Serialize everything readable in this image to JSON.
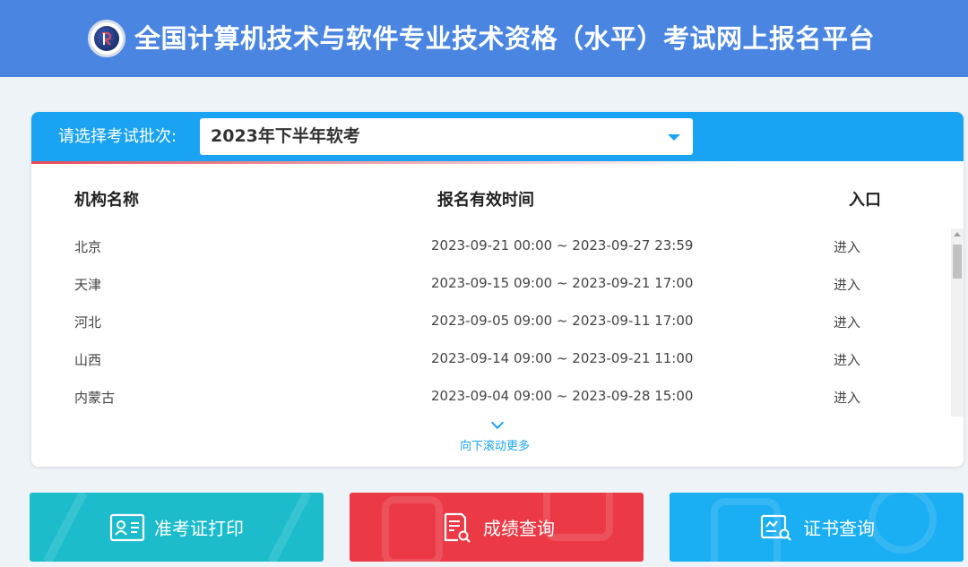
{
  "header": {
    "title": "全国计算机技术与软件专业技术资格（水平）考试网上报名平台"
  },
  "batch": {
    "label": "请选择考试批次:",
    "selected": "2023年下半年软考"
  },
  "table": {
    "columns": [
      "机构名称",
      "报名有效时间",
      "入口"
    ],
    "rows": [
      {
        "name": "北京",
        "time": "2023-09-21 00:00 ~ 2023-09-27 23:59",
        "entry": "进入"
      },
      {
        "name": "天津",
        "time": "2023-09-15 09:00 ~ 2023-09-21 17:00",
        "entry": "进入"
      },
      {
        "name": "河北",
        "time": "2023-09-05 09:00 ~ 2023-09-11 17:00",
        "entry": "进入"
      },
      {
        "name": "山西",
        "time": "2023-09-14 09:00 ~ 2023-09-21 11:00",
        "entry": "进入"
      },
      {
        "name": "内蒙古",
        "time": "2023-09-04 09:00 ~ 2023-09-28 15:00",
        "entry": "进入"
      }
    ]
  },
  "more_hint": "向下滚动更多",
  "actions": [
    {
      "label": "准考证打印",
      "icon": "id-card-icon",
      "color": "#1cbccc"
    },
    {
      "label": "成绩查询",
      "icon": "document-search-icon",
      "color": "#eb3a45"
    },
    {
      "label": "证书查询",
      "icon": "certificate-search-icon",
      "color": "#1aaef3"
    }
  ]
}
